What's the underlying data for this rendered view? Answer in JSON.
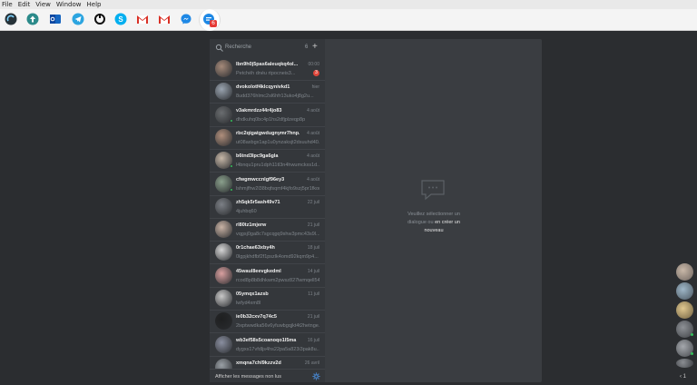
{
  "menu": [
    "File",
    "Edit",
    "View",
    "Window",
    "Help"
  ],
  "services": [
    {
      "icon": "ferdi-icon",
      "color": "#263238"
    },
    {
      "icon": "upload-icon",
      "color": "#2b8a8a"
    },
    {
      "icon": "outlook-icon",
      "color": "#1565c0"
    },
    {
      "icon": "telegram-icon",
      "color": "#2ca5e0"
    },
    {
      "icon": "power-icon",
      "color": "#111111"
    },
    {
      "icon": "skype-icon",
      "color": "#00aff0"
    },
    {
      "icon": "gmail-icon",
      "color": "#d93025"
    },
    {
      "icon": "gmail-icon",
      "color": "#d93025"
    },
    {
      "icon": "messenger-icon",
      "color": "#1e88e5"
    },
    {
      "icon": "chat-bubble-icon",
      "color": "#1e88e5"
    }
  ],
  "active_badge": "6",
  "search": {
    "placeholder": "Recherche",
    "count": "6"
  },
  "conversations": [
    {
      "name": "lbn9h0j5pas6aleuqkq4ol...",
      "snippet": "Petchéh dnéu rtpocneis3...",
      "date": "00:00",
      "unread": "3",
      "avatar": "#a58a7a"
    },
    {
      "name": "dvokolotf4klcqynivkd1",
      "snippet": "8udd376hlmc2sl6hfr13uko4j8g2u...",
      "date": "hier",
      "unread": "",
      "avatar": "#9aa4b0"
    },
    {
      "name": "v3akmrdzz44r4jo83",
      "snippet": "dhdkuhq0bc4p1hs2dfjplzeqp8p",
      "date": "4 août",
      "unread": "",
      "avatar": "#6a6d70"
    },
    {
      "name": "rbc2qigatgwdugnymr7hnp...",
      "snippet": "ut08axbgx1ap1u0ynzaksjt2dsuuhd40...",
      "date": "4 août",
      "unread": "",
      "avatar": "#b08f7c"
    },
    {
      "name": "b6tnd3lpc9ga6gla",
      "snippet": "l4bnqu1pru1dph11tl3n4hwumckxs1d...",
      "date": "4 août",
      "unread": "",
      "avatar": "#c7b8a8"
    },
    {
      "name": "cfwgmwccnlgf96ey3",
      "snippet": "lshmjfhw2l38bqfsqmf4kjfo9szj5pr1fkom...",
      "date": "4 août",
      "unread": "",
      "avatar": "#8aa08c"
    },
    {
      "name": "zh5qk5r5ash49v71",
      "snippet": "4juhbq60",
      "date": "22 juil",
      "unread": "",
      "avatar": "#7c8086"
    },
    {
      "name": "rl80tz1mjerw",
      "snippet": "vqgsj0ga8c7sgcqgq9shw3pmc43s9l...",
      "date": "21 juil",
      "unread": "",
      "avatar": "#c9b3a5"
    },
    {
      "name": "0r1chae63xby4h",
      "snippet": "0lgpjkhdfbf2f1pszlk4omd92kqm9p4...",
      "date": "18 juil",
      "unread": "",
      "avatar": "#d6d6d6"
    },
    {
      "name": "45waul8eevgkedml",
      "snippet": "rcod8p8b8dhkwm2pwsz827lwmqell54...",
      "date": "14 juil",
      "unread": "",
      "avatar": "#d9a0a0"
    },
    {
      "name": "05ymqx1azsb",
      "snippet": "lwfyd4xm8l",
      "date": "11 juil",
      "unread": "",
      "avatar": "#c8c8c8"
    },
    {
      "name": "ie0b32cxv7q74c5",
      "snippet": "2ixptwwdka56v6yfuwbgqjkt4t2hetnge...",
      "date": "21 juil",
      "unread": "",
      "avatar": "#1e1f20"
    },
    {
      "name": "wb3ef58s5coanoqo1l5ma",
      "snippet": "dygxs17vfdljs4hs22pa5a823i3pak8u...",
      "date": "16 juil",
      "unread": "",
      "avatar": "#8a8fa0"
    },
    {
      "name": "xmqna7chl9kzzv2d",
      "snippet": "",
      "date": "26 avril",
      "unread": "",
      "avatar": "#9aa0a6"
    }
  ],
  "footer_label": "Afficher les messages non lus",
  "empty_state": {
    "line1": "Veuillez sélectionner un",
    "line2a": "dialogue ou",
    "link": "en créer un",
    "line3": "nouveau"
  },
  "right_bottom": "‹ 1"
}
